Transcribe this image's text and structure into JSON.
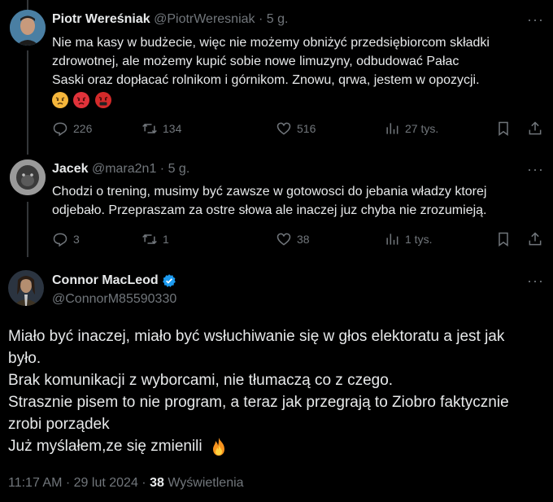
{
  "tweets": [
    {
      "name": "Piotr Wereśniak",
      "handle": "@PiotrWeresniak",
      "time": "· 5 g.",
      "lines": [
        "Nie ma kasy w budżecie, więc nie możemy obniżyć przedsiębiorcom składki",
        "zdrowotnej, ale możemy kupić sobie nowe limuzyny, odbudować Pałac",
        "Saski oraz dopłacać rolnikom i górnikom. Znowu, qrwa, jestem w opozycji."
      ],
      "emojis": [
        "angry-face-emoji",
        "red-angry-face-emoji",
        "cursing-face-emoji"
      ],
      "replies": "226",
      "retweets": "134",
      "likes": "516",
      "views": "27 tys."
    },
    {
      "name": "Jacek",
      "handle": "@mara2n1",
      "time": "· 5 g.",
      "lines": [
        "Chodzi o trening, musimy być zawsze w gotowosci do jebania władzy ktorej",
        "odjebało. Przepraszam za ostre słowa ale inaczej juz chyba nie zrozumieją."
      ],
      "replies": "3",
      "retweets": "1",
      "likes": "38",
      "views": "1 tys."
    }
  ],
  "main": {
    "name": "Connor MacLeod",
    "handle": "@ConnorM85590330",
    "lines": [
      "Miało być inaczej, miało być wsłuchiwanie się w głos elektoratu a jest jak",
      "było.",
      "Brak komunikacji z wyborcami, nie tłumaczą co z czego.",
      "Strasznie pisem to nie program, a teraz jak przegrają to Ziobro faktycznie",
      "zrobi porządek",
      "Już myślałem,ze się zmienili"
    ],
    "emoji": "fire-emoji",
    "time": "11:17 AM",
    "date": "29 lut 2024",
    "views_count": "38",
    "views_label": "Wyświetlenia"
  },
  "colors": {
    "background": "#000000",
    "text": "#e7e9ea",
    "muted": "#71767b",
    "verified": "#1d9bf0"
  }
}
